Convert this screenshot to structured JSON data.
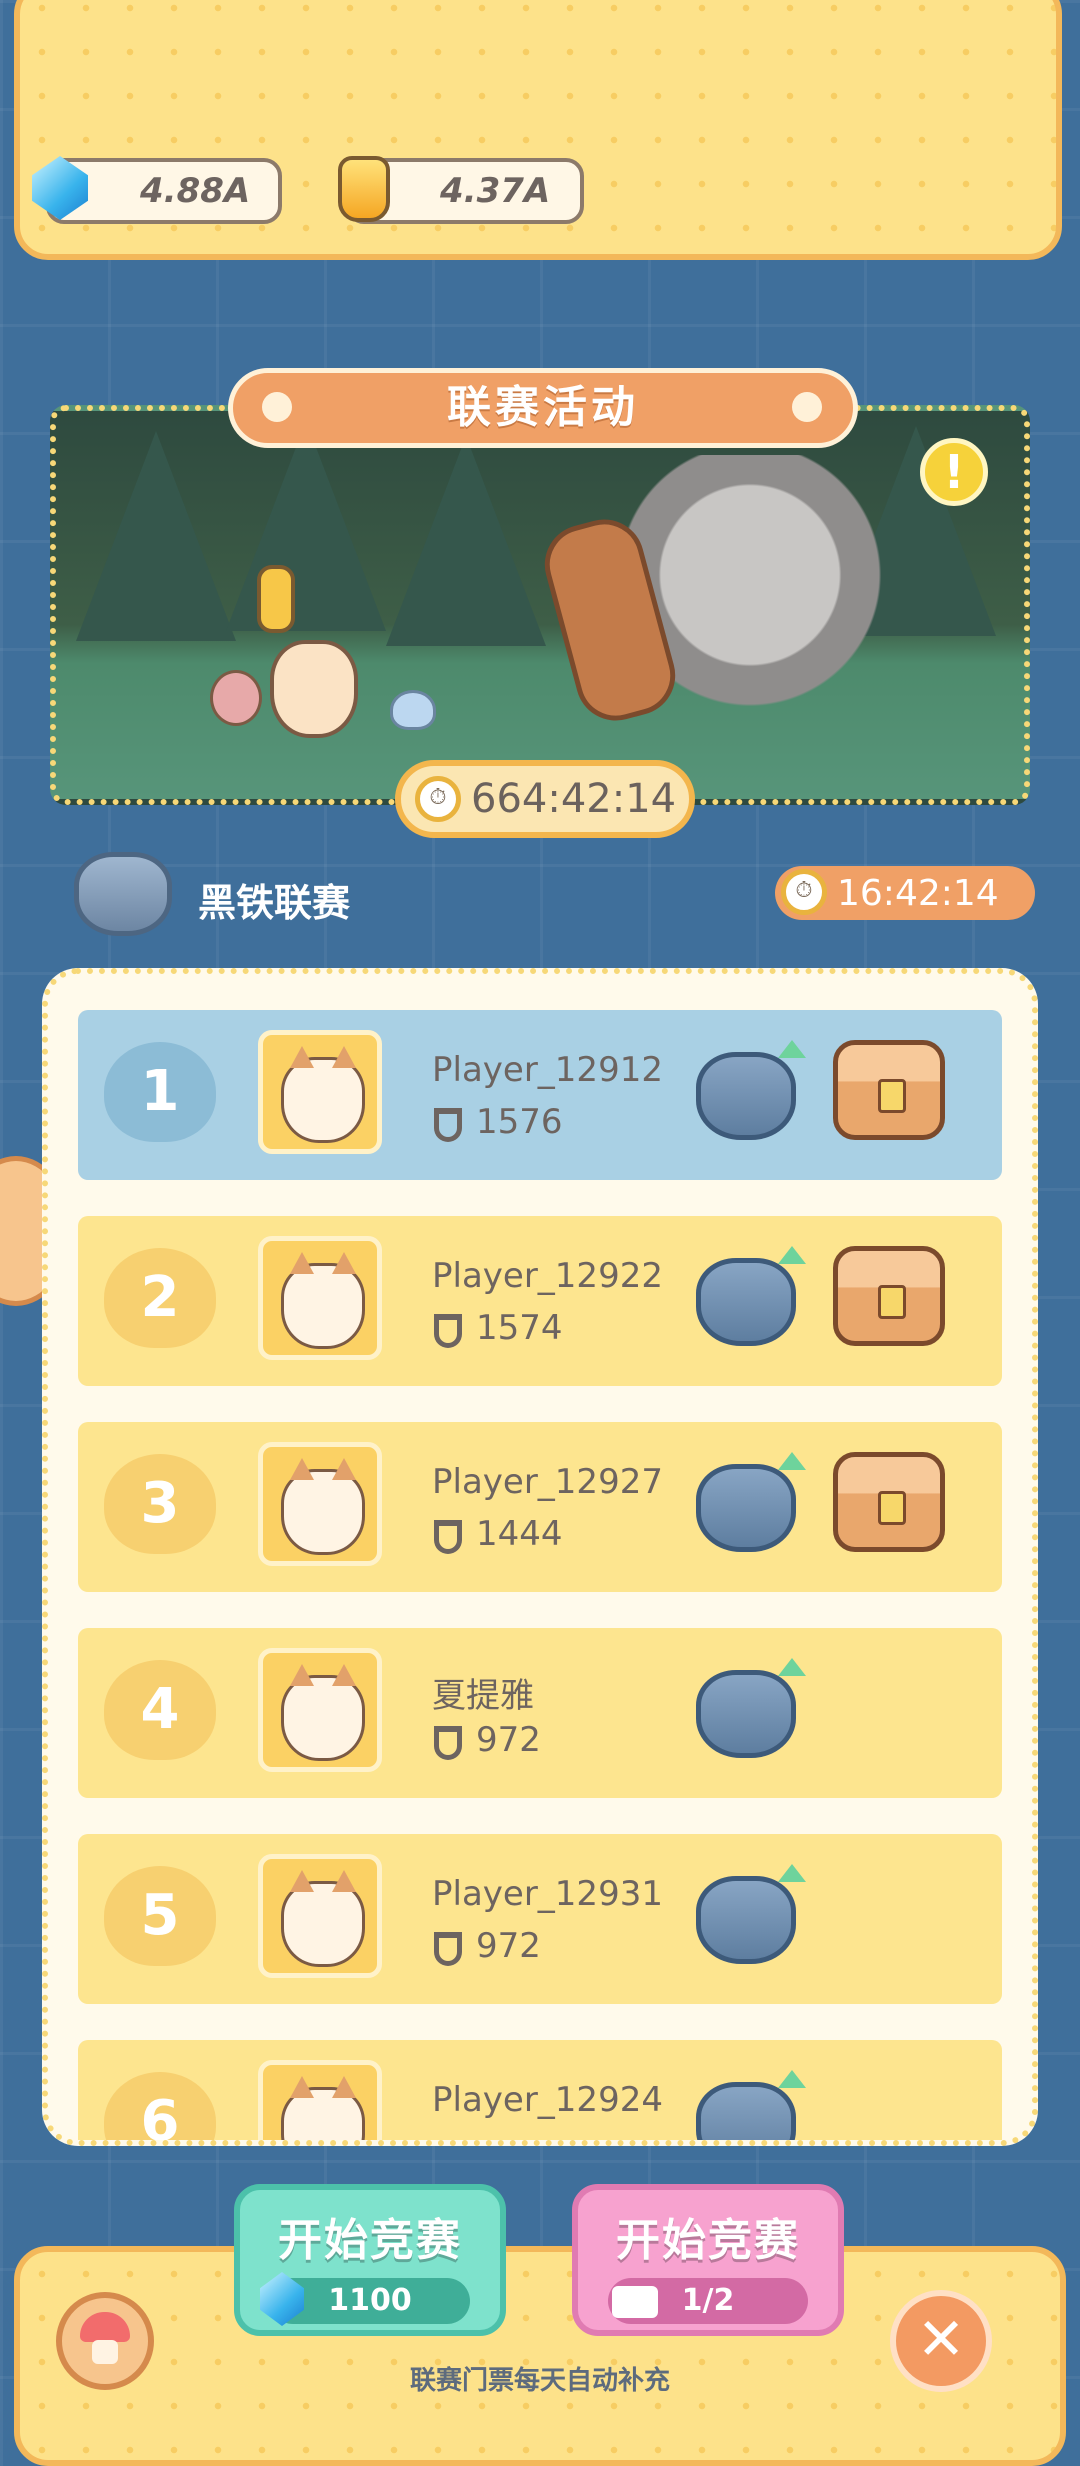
{
  "currencies": [
    {
      "icon": "gem-icon",
      "value": "4.88A"
    },
    {
      "icon": "potion-icon",
      "value": "4.37A"
    }
  ],
  "event": {
    "title": "联赛活动",
    "countdown": "664:42:14"
  },
  "league": {
    "name": "黑铁联赛",
    "countdown": "16:42:14"
  },
  "leaderboard": [
    {
      "rank": "1",
      "name": "Player_12912",
      "score": "1576",
      "promote": true,
      "reward": "chest"
    },
    {
      "rank": "2",
      "name": "Player_12922",
      "score": "1574",
      "promote": true,
      "reward": "chest"
    },
    {
      "rank": "3",
      "name": "Player_12927",
      "score": "1444",
      "promote": true,
      "reward": "chest"
    },
    {
      "rank": "4",
      "name": "夏提雅",
      "score": "972",
      "promote": true,
      "reward": ""
    },
    {
      "rank": "5",
      "name": "Player_12931",
      "score": "972",
      "promote": true,
      "reward": ""
    },
    {
      "rank": "6",
      "name": "Player_12924",
      "score": "",
      "promote": true,
      "reward": ""
    }
  ],
  "actions": {
    "start_gem": {
      "label": "开始竞赛",
      "cost": "1100"
    },
    "start_ticket": {
      "label": "开始竞赛",
      "tickets": "1/2"
    }
  },
  "footer_note": "联赛门票每天自动补充",
  "colors": {
    "accent_orange": "#f0a066",
    "panel_yellow": "#fde28a",
    "first_row_blue": "#a9d0e4",
    "button_green": "#7ee2cc",
    "button_pink": "#f7a2cf"
  }
}
